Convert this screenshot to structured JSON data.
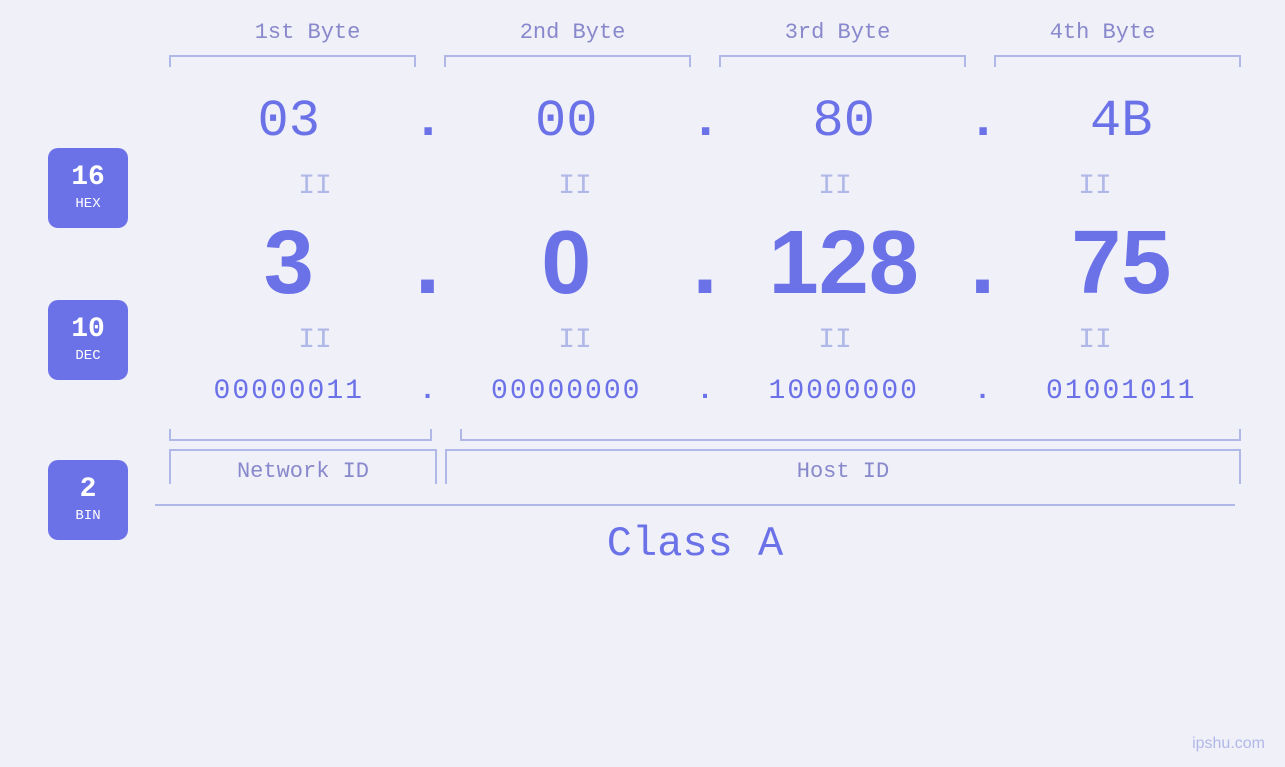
{
  "badges": {
    "hex": {
      "number": "16",
      "label": "HEX"
    },
    "dec": {
      "number": "10",
      "label": "DEC"
    },
    "bin": {
      "number": "2",
      "label": "BIN"
    }
  },
  "headers": {
    "byte1": "1st Byte",
    "byte2": "2nd Byte",
    "byte3": "3rd Byte",
    "byte4": "4th Byte"
  },
  "hex_values": [
    "03",
    "00",
    "80",
    "4B"
  ],
  "dec_values": [
    "3",
    "0",
    "128",
    "75"
  ],
  "bin_values": [
    "00000011",
    "00000000",
    "10000000",
    "01001011"
  ],
  "labels": {
    "network_id": "Network ID",
    "host_id": "Host ID",
    "class": "Class A"
  },
  "watermark": "ipshu.com",
  "dot": ".",
  "equals": "II"
}
